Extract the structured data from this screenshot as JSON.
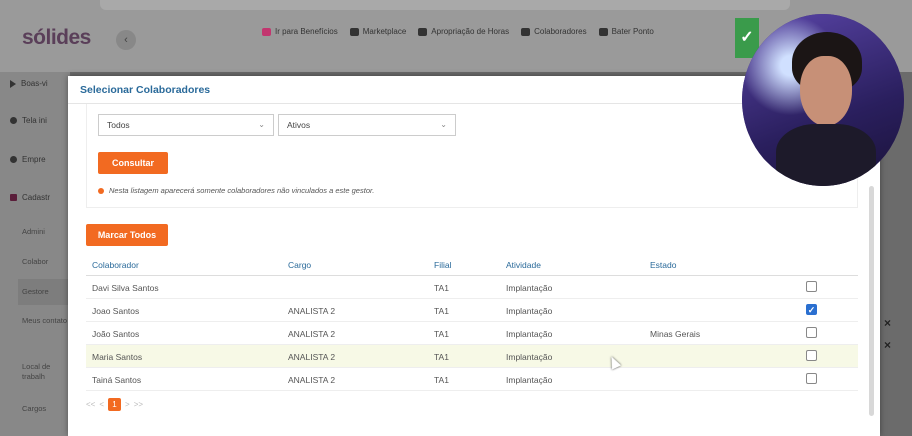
{
  "app": {
    "logo": "sólides",
    "collapse_icon": "‹",
    "nav": [
      {
        "label": "Ir para Benefícios",
        "icon": "gift-icon"
      },
      {
        "label": "Marketplace",
        "icon": "cart-icon"
      },
      {
        "label": "Apropriação de Horas",
        "icon": "users-icon"
      },
      {
        "label": "Colaboradores",
        "icon": "document-icon"
      },
      {
        "label": "Bater Ponto",
        "icon": "clock-icon"
      }
    ]
  },
  "sidebar": {
    "items": [
      {
        "label": "Boas-vi",
        "icon": "play-icon"
      },
      {
        "label": "Tela ini",
        "icon": "home-icon"
      },
      {
        "label": "Empre",
        "icon": "building-icon"
      },
      {
        "label": "Cadastr",
        "icon": "register-icon"
      }
    ],
    "subitems": [
      "Admini",
      "Colabor",
      "Gestore",
      "Meus contato",
      "Local de trabalh",
      "Cargos"
    ]
  },
  "modal": {
    "title": "Selecionar Colaboradores",
    "filter_1": "Todos",
    "filter_2": "Ativos",
    "consultar_label": "Consultar",
    "note": "Nesta listagem aparecerá somente colaboradores não vinculados a este gestor.",
    "marcar_todos_label": "Marcar Todos",
    "columns": [
      "Colaborador",
      "Cargo",
      "Filial",
      "Atividade",
      "Estado"
    ],
    "rows": [
      {
        "colaborador": "Davi Silva Santos",
        "cargo": "",
        "filial": "TA1",
        "atividade": "Implantação",
        "estado": "",
        "checked": false
      },
      {
        "colaborador": "Joao Santos",
        "cargo": "ANALISTA 2",
        "filial": "TA1",
        "atividade": "Implantação",
        "estado": "",
        "checked": true
      },
      {
        "colaborador": "João Santos",
        "cargo": "ANALISTA 2",
        "filial": "TA1",
        "atividade": "Implantação",
        "estado": "Minas Gerais",
        "checked": false
      },
      {
        "colaborador": "Maria Santos",
        "cargo": "ANALISTA 2",
        "filial": "TA1",
        "atividade": "Implantação",
        "estado": "",
        "checked": false
      },
      {
        "colaborador": "Tainá Santos",
        "cargo": "ANALISTA 2",
        "filial": "TA1",
        "atividade": "Implantação",
        "estado": "",
        "checked": false
      }
    ],
    "pager": {
      "first": "<<",
      "prev": "<",
      "current": "1",
      "next": ">",
      "last": ">>"
    }
  },
  "colors": {
    "accent": "#f26a21",
    "link": "#2a6a9a",
    "checkbox": "#2a6fd0",
    "highlight_row": "#f7f9e6"
  }
}
